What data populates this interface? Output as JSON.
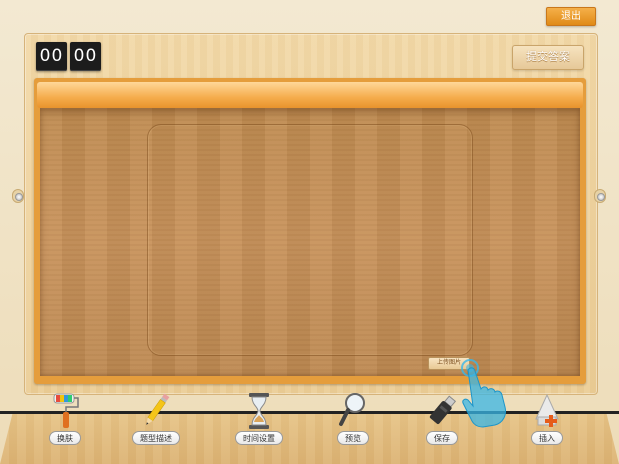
{
  "header": {
    "exit_label": "退出"
  },
  "timer": {
    "minutes": "00",
    "seconds": "00"
  },
  "actions": {
    "submit_label": "提交答案",
    "upload_label": "上传图片"
  },
  "toolbar": {
    "items": [
      {
        "label": "换肤",
        "icon": "paint-roller-icon"
      },
      {
        "label": "题型描述",
        "icon": "pencil-icon"
      },
      {
        "label": "时间设置",
        "icon": "hourglass-icon"
      },
      {
        "label": "预览",
        "icon": "magnifier-icon"
      },
      {
        "label": "保存",
        "icon": "usb-drive-icon"
      },
      {
        "label": "插入",
        "icon": "insert-icon"
      }
    ]
  },
  "colors": {
    "accent_orange": "#e59d3c",
    "exit_orange": "#f0a030",
    "wood_dark": "#c18b52",
    "wood_light": "#efd3a0",
    "timer_bg": "#1c1c1c"
  }
}
